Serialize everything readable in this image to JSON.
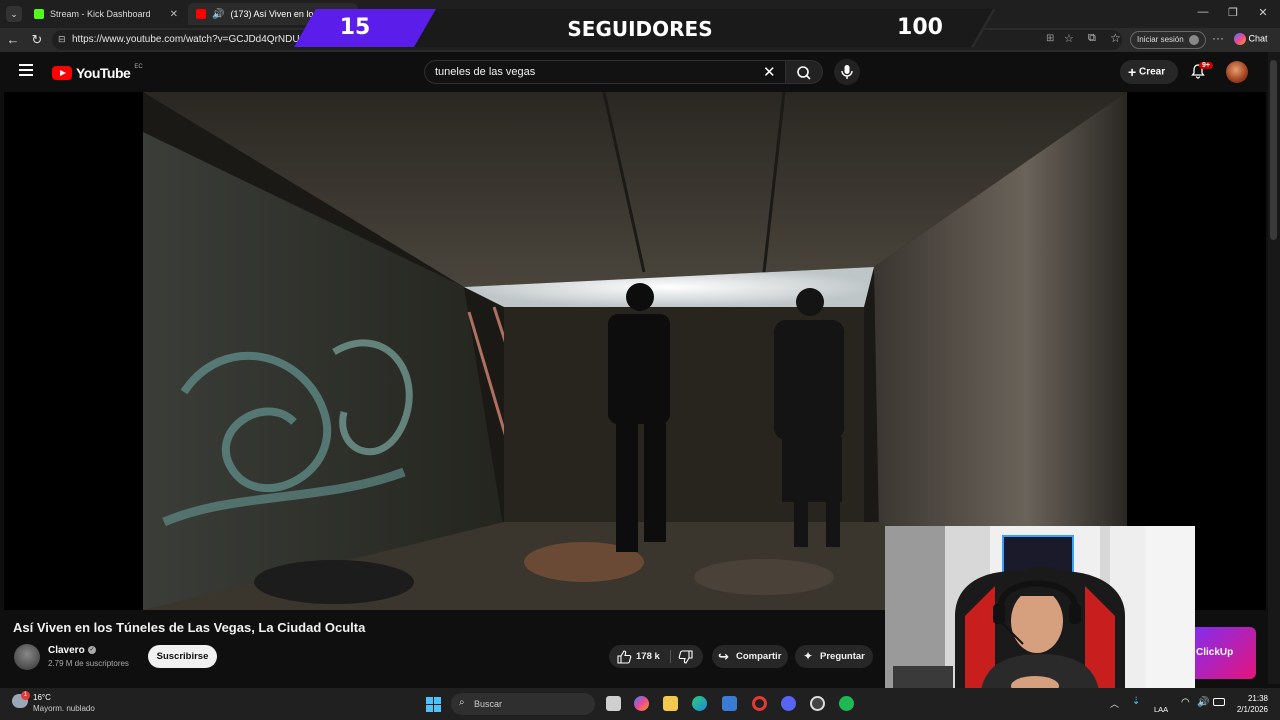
{
  "browser": {
    "tabs": [
      {
        "label": "Stream - Kick Dashboard",
        "favicon_color": "#53fc18"
      },
      {
        "label": "(173) Así Viven en los Túne",
        "favicon_color": "#ff0000"
      }
    ],
    "url": "https://www.youtube.com/watch?v=GCJDd4QrNDU",
    "signin_label": "Iniciar sesión",
    "chat_label": "Chat"
  },
  "stream_overlay": {
    "followers_count": "15",
    "label": "SEGUIDORES",
    "goal": "100"
  },
  "youtube": {
    "logo_text": "YouTube",
    "country_code": "EC",
    "search_value": "tuneles de las vegas",
    "create_label": "Crear",
    "notifications_badge": "9+",
    "video": {
      "title": "Así Viven en los Túneles de Las Vegas, La Ciudad Oculta",
      "channel_name": "Clavero",
      "subscribers": "2.79 M de suscriptores",
      "subscribe_label": "Suscribirse",
      "likes": "178 k",
      "share_label": "Compartir",
      "ask_label": "Preguntar"
    },
    "ad_label": "ClickUp",
    "accent_color": "#ff0000"
  },
  "taskbar": {
    "weather_temp": "16°C",
    "weather_desc": "Mayorm. nublado",
    "search_placeholder": "Buscar",
    "lang": "LAA",
    "time": "21:38",
    "date": "2/1/2026",
    "weather_badge": "1"
  }
}
